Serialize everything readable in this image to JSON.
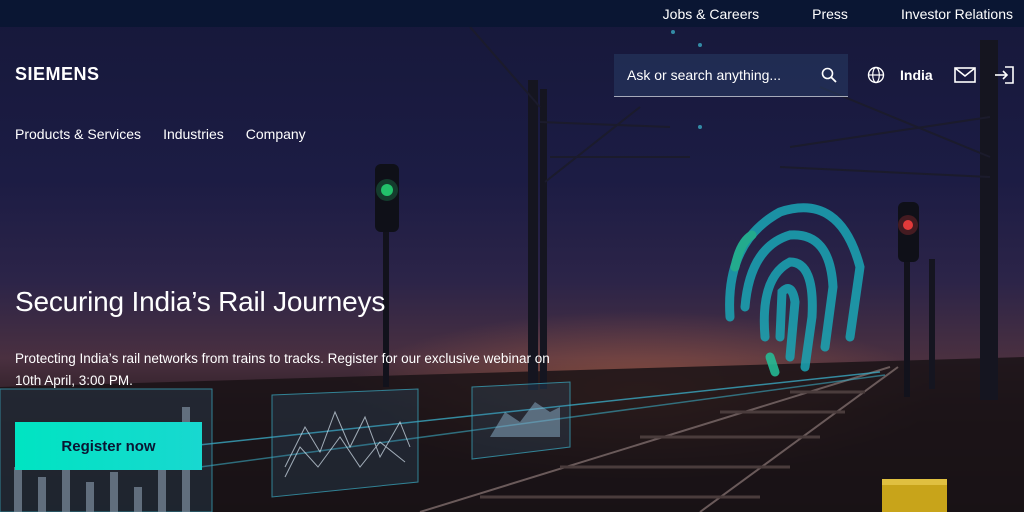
{
  "topbar": {
    "links": [
      "Jobs & Careers",
      "Press",
      "Investor Relations"
    ]
  },
  "header": {
    "logo": "SIEMENS",
    "search_placeholder": "Ask or search anything...",
    "country": "India",
    "icons": [
      "search-icon",
      "globe-icon",
      "mail-icon",
      "login-icon"
    ]
  },
  "nav": {
    "items": [
      "Products & Services",
      "Industries",
      "Company"
    ]
  },
  "hero": {
    "title": "Securing India’s Rail Journeys",
    "text": "Protecting India’s rail networks from trains to tracks. Register for our exclusive webinar on 10th April, 3:00 PM.",
    "cta": "Register now"
  },
  "colors": {
    "topbar": "#0a1633",
    "accent": "#00e4c2",
    "fingerprint": "#1aa6b5"
  }
}
